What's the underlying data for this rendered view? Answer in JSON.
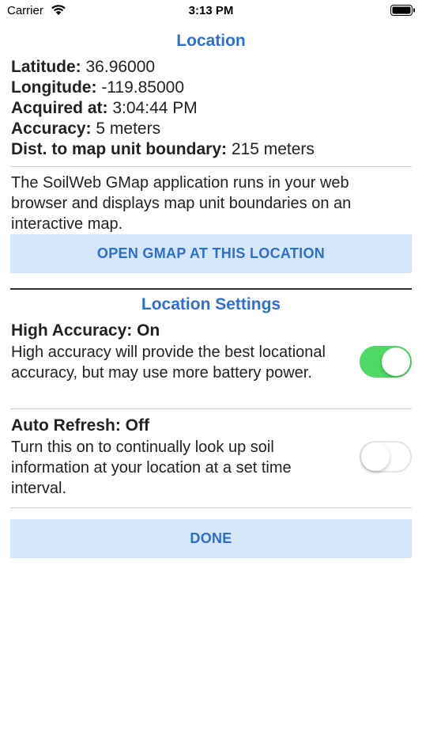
{
  "status_bar": {
    "carrier": "Carrier",
    "time": "3:13 PM"
  },
  "location": {
    "title": "Location",
    "latitude_label": "Latitude:",
    "latitude_value": "36.96000",
    "longitude_label": "Longitude:",
    "longitude_value": "-119.85000",
    "acquired_label": "Acquired at:",
    "acquired_value": "3:04:44 PM",
    "accuracy_label": "Accuracy:",
    "accuracy_value": "5 meters",
    "boundary_label": "Dist. to map unit boundary:",
    "boundary_value": "215 meters",
    "intro_text": "The SoilWeb GMap application runs in your web browser and displays map unit boundaries on an interactive map.",
    "gmap_button": "OPEN GMAP AT THIS LOCATION"
  },
  "settings": {
    "title": "Location Settings",
    "high_accuracy": {
      "label": "High Accuracy: On",
      "description": "High accuracy will provide the best locational accuracy, but may use more battery power.",
      "enabled": true
    },
    "auto_refresh": {
      "label": "Auto Refresh: Off",
      "description": "Turn this on to continually look up soil information at your location at a set time interval.",
      "enabled": false
    },
    "done_button": "DONE"
  },
  "colors": {
    "accent": "#2f6fd0",
    "button_bg": "#d4e7fd",
    "toggle_on": "#4cd964"
  },
  "icons": [
    "wifi-icon",
    "battery-icon"
  ]
}
